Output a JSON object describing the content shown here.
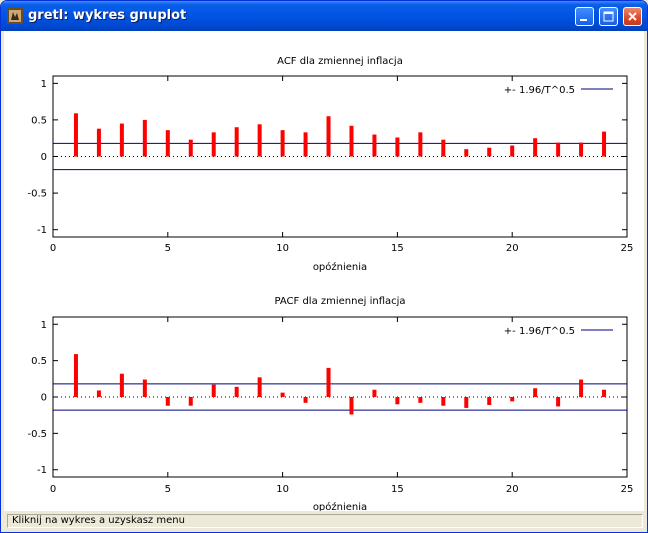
{
  "window": {
    "title": "gretl: wykres gnuplot",
    "status_text": "Kliknij na wykres a uzyskasz menu",
    "accent_color": "#0054e3"
  },
  "chart_data": [
    {
      "type": "bar",
      "title": "ACF dla zmiennej inflacja",
      "xlabel": "opóźnienia",
      "ylabel": "",
      "xlim": [
        0,
        25
      ],
      "ylim": [
        -1.1,
        1.1
      ],
      "xticks": [
        0,
        5,
        10,
        15,
        20,
        25
      ],
      "yticks": [
        1,
        0.5,
        0,
        -0.5,
        -1
      ],
      "ytick_labels": [
        "1",
        "0.5",
        "0",
        "-0.5",
        "-1"
      ],
      "x": [
        1,
        2,
        3,
        4,
        5,
        6,
        7,
        8,
        9,
        10,
        11,
        12,
        13,
        14,
        15,
        16,
        17,
        18,
        19,
        20,
        21,
        22,
        23,
        24
      ],
      "values": [
        0.59,
        0.38,
        0.45,
        0.5,
        0.36,
        0.23,
        0.33,
        0.4,
        0.44,
        0.36,
        0.33,
        0.55,
        0.42,
        0.3,
        0.26,
        0.33,
        0.23,
        0.1,
        0.12,
        0.15,
        0.25,
        0.19,
        0.19,
        0.34
      ],
      "bar_color": "#ff0000",
      "bound_label": "+- 1.96/T^0.5",
      "bound_value": 0.18,
      "bound_color": "#000080",
      "grid": false,
      "legend_position": "top-right"
    },
    {
      "type": "bar",
      "title": "PACF dla zmiennej inflacja",
      "xlabel": "opóźnienia",
      "ylabel": "",
      "xlim": [
        0,
        25
      ],
      "ylim": [
        -1.1,
        1.1
      ],
      "xticks": [
        0,
        5,
        10,
        15,
        20,
        25
      ],
      "yticks": [
        1,
        0.5,
        0,
        -0.5,
        -1
      ],
      "ytick_labels": [
        "1",
        "0.5",
        "0",
        "-0.5",
        "-1"
      ],
      "x": [
        1,
        2,
        3,
        4,
        5,
        6,
        7,
        8,
        9,
        10,
        11,
        12,
        13,
        14,
        15,
        16,
        17,
        18,
        19,
        20,
        21,
        22,
        23,
        24
      ],
      "values": [
        0.59,
        0.09,
        0.32,
        0.24,
        -0.12,
        -0.12,
        0.17,
        0.14,
        0.27,
        0.06,
        -0.08,
        0.4,
        -0.24,
        0.1,
        -0.1,
        -0.08,
        -0.12,
        -0.15,
        -0.11,
        -0.06,
        0.12,
        -0.13,
        0.24,
        0.1
      ],
      "bar_color": "#ff0000",
      "bound_label": "+- 1.96/T^0.5",
      "bound_value": 0.18,
      "bound_color": "#000080",
      "grid": false,
      "legend_position": "top-right"
    }
  ]
}
